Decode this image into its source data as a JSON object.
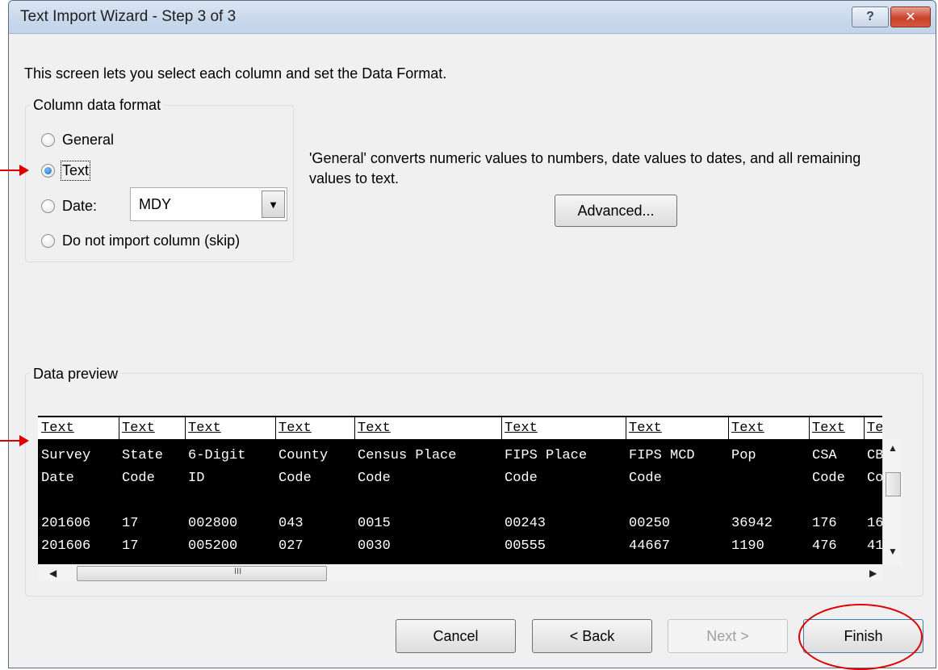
{
  "window": {
    "title": "Text Import Wizard - Step 3 of 3",
    "help_icon": "help-icon",
    "close_icon": "close-icon",
    "help_glyph": "?",
    "close_glyph": "✕"
  },
  "intro_text": "This screen lets you select each column and set the Data Format.",
  "column_format": {
    "legend": "Column data format",
    "options": [
      {
        "label": "General",
        "selected": false
      },
      {
        "label": "Text",
        "selected": true
      },
      {
        "label": "Date:",
        "selected": false
      },
      {
        "label": "Do not import column (skip)",
        "selected": false
      }
    ],
    "date_combo_value": "MDY",
    "combo_arrow": "▼"
  },
  "description": "'General' converts numeric values to numbers, date values to dates, and all remaining values to text.",
  "advanced_button": "Advanced...",
  "data_preview": {
    "legend": "Data preview",
    "headers": [
      "Text",
      "Text",
      "Text",
      "Text",
      "Text",
      "Text",
      "Text",
      "Text",
      "Text",
      "Text"
    ],
    "rows": [
      [
        "Survey",
        "State",
        "6-Digit",
        "County",
        "Census Place",
        "FIPS Place",
        "FIPS MCD",
        "Pop",
        "CSA",
        "CB"
      ],
      [
        "Date",
        "Code",
        "ID",
        "Code",
        "Code",
        "Code",
        "Code",
        "",
        "Code",
        "Co"
      ],
      [
        "",
        "",
        "",
        "",
        "",
        "",
        "",
        "",
        "",
        ""
      ],
      [
        "201606",
        "17",
        "002800",
        "043",
        "0015",
        "00243",
        "00250",
        "36942",
        "176",
        "16"
      ],
      [
        "201606",
        "17",
        "005200",
        "027",
        "0030",
        "00555",
        "44667",
        "1190",
        "476",
        "41"
      ]
    ],
    "grip": "III",
    "arrow_left": "◀",
    "arrow_right": "▶",
    "arrow_up": "▲",
    "arrow_down": "▼"
  },
  "buttons": {
    "cancel": "Cancel",
    "back": "< Back",
    "next": "Next >",
    "finish": "Finish"
  },
  "colors": {
    "annotation": "#dd0000",
    "preview_bg": "#000000"
  }
}
